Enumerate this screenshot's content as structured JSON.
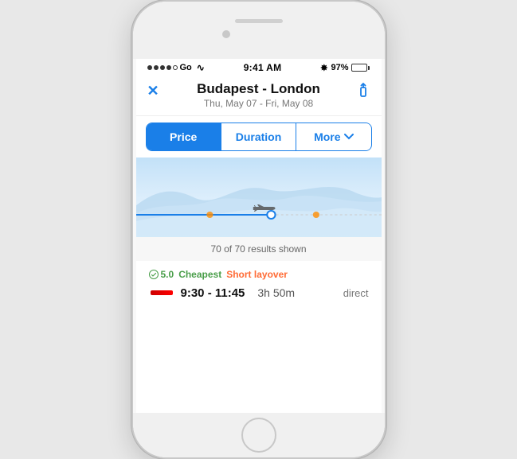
{
  "phone": {
    "status_bar": {
      "carrier": "Go",
      "time": "9:41 AM",
      "bluetooth": "97%"
    },
    "header": {
      "close_label": "✕",
      "share_label": "⬆",
      "route": "Budapest - London",
      "dates": "Thu, May 07 - Fri, May 08"
    },
    "tabs": [
      {
        "label": "Price",
        "state": "active"
      },
      {
        "label": "Duration",
        "state": "inactive"
      },
      {
        "label": "More",
        "state": "inactive"
      }
    ],
    "results": {
      "count_text": "70 of  70 results shown"
    },
    "flights": [
      {
        "rating": "5.0",
        "badge_cheapest": "Cheapest",
        "badge_layover": "Short layover",
        "times": "9:30 - 11:45",
        "duration": "3h 50m",
        "type": "direct"
      }
    ]
  }
}
